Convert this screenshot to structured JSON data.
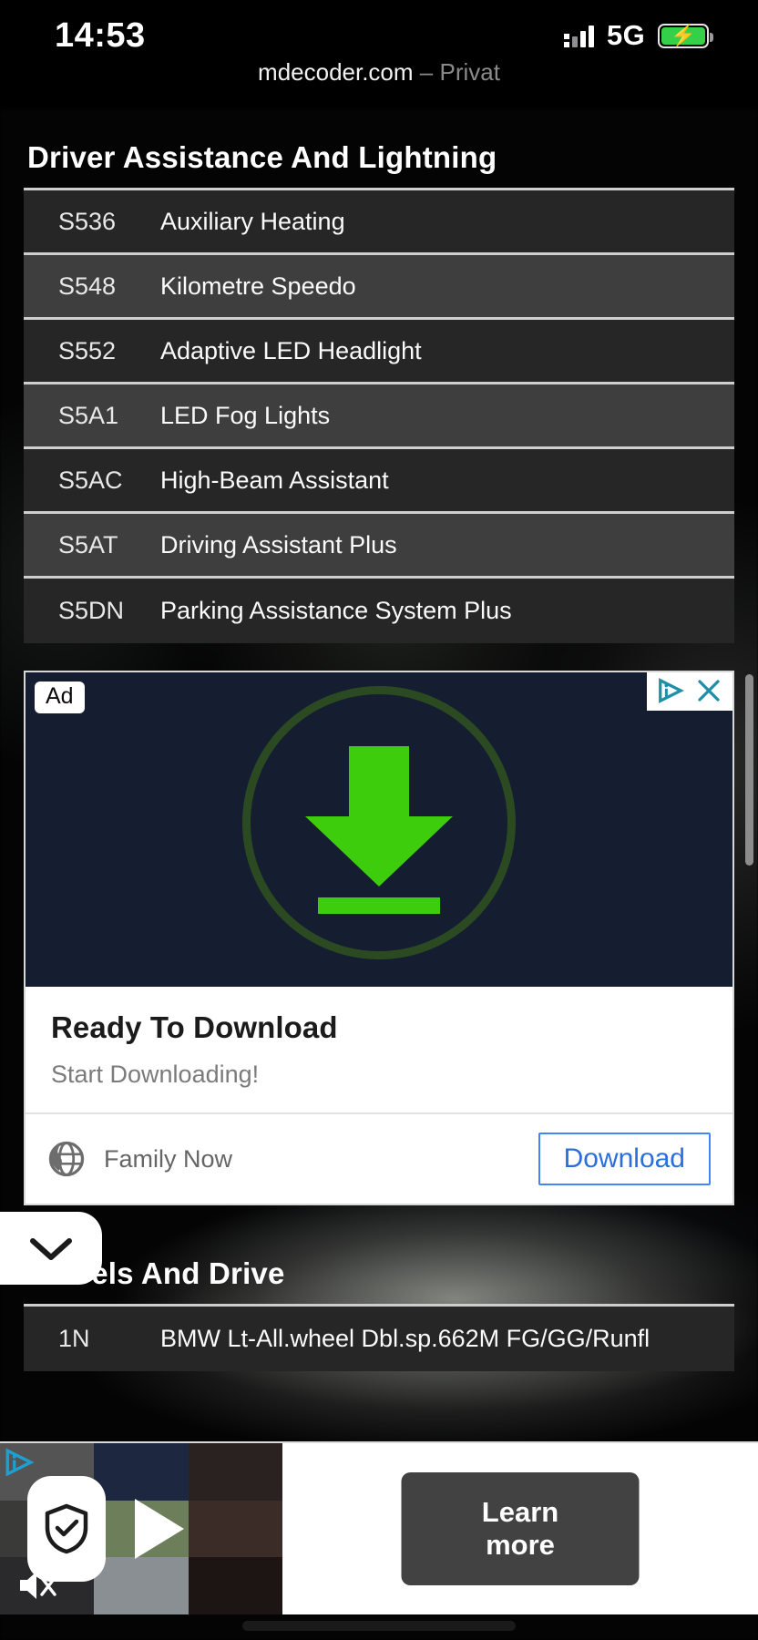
{
  "status_bar": {
    "time": "14:53",
    "network": "5G",
    "signal_icon": "signal-bars-icon",
    "battery_icon": "battery-charging-icon"
  },
  "browser": {
    "host": "mdecoder.com",
    "mode": "– Privat"
  },
  "sections": [
    {
      "title": "Driver Assistance And Lightning",
      "rows": [
        {
          "code": "S536",
          "desc": "Auxiliary Heating"
        },
        {
          "code": "S548",
          "desc": "Kilometre Speedo"
        },
        {
          "code": "S552",
          "desc": "Adaptive LED Headlight"
        },
        {
          "code": "S5A1",
          "desc": "LED Fog Lights"
        },
        {
          "code": "S5AC",
          "desc": "High-Beam Assistant"
        },
        {
          "code": "S5AT",
          "desc": "Driving Assistant Plus"
        },
        {
          "code": "S5DN",
          "desc": "Parking Assistance System Plus"
        }
      ]
    },
    {
      "title": "Wheels And Drive",
      "rows": [
        {
          "code": "1N",
          "desc": "BMW Lt-All.wheel Dbl.sp.662M FG/GG/Runfl"
        }
      ]
    }
  ],
  "inline_ad": {
    "badge": "Ad",
    "adchoices_icon": "adchoices-icon",
    "close_icon": "close-icon",
    "creative_icon": "download-arrow-icon",
    "headline": "Ready To Download",
    "subtext": "Start Downloading!",
    "advertiser": "Family Now",
    "advertiser_icon": "globe-icon",
    "cta_label": "Download",
    "colors": {
      "creative_bg": "#151d30",
      "arrow_green": "#3ecd0c",
      "ring_green": "#2c4a22",
      "cta_blue": "#2b6fdd",
      "adchoices_teal": "#1f8fa8"
    }
  },
  "sticky_ad": {
    "adchoices_icon": "adchoices-icon",
    "shield_icon": "shield-check-icon",
    "mute_icon": "mute-icon",
    "play_icon": "play-icon",
    "cta_label": "Learn more"
  },
  "collapse_control": {
    "icon": "chevron-down-icon"
  },
  "home_indicator": "home-indicator"
}
